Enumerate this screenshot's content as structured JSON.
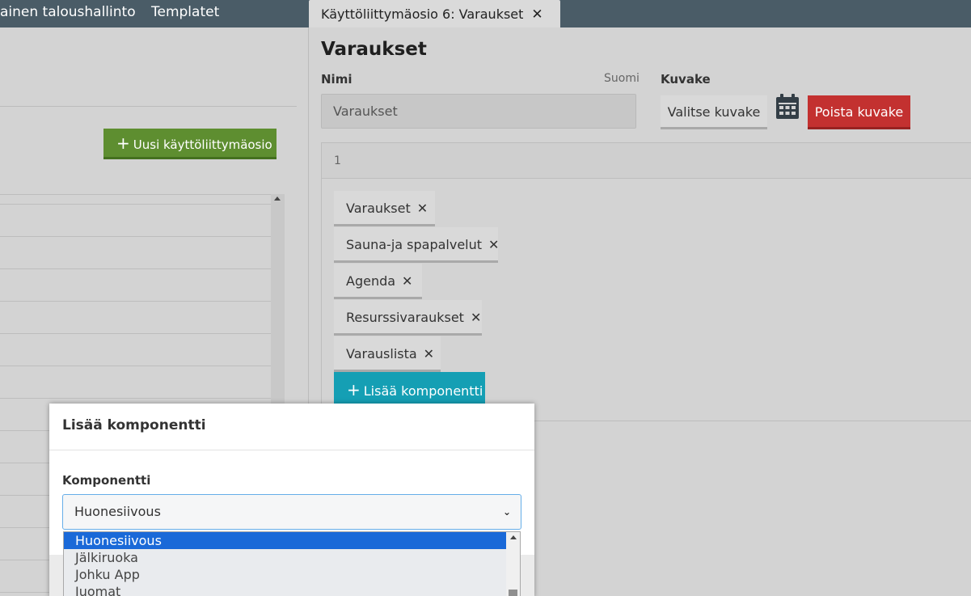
{
  "topbar": {
    "nav_items": [
      "ainen taloushallinto",
      "Templatet"
    ],
    "tab": {
      "label": "Käyttöliittymäosio 6: Varaukset",
      "close": "✕"
    }
  },
  "left": {
    "add_button": "Uusi käyttöliittymäosio",
    "add_icon": "plus-icon"
  },
  "form": {
    "title": "Varaukset",
    "name_label": "Nimi",
    "language": "Suomi",
    "name_value": "Varaukset",
    "icon_label": "Kuvake",
    "choose_icon_button": "Valitse kuvake",
    "icon": "calendar-icon",
    "remove_icon_button": "Poista kuvake"
  },
  "section": {
    "number": "1",
    "components": [
      {
        "label": "Varaukset",
        "close": "✕"
      },
      {
        "label": "Sauna-ja spapalvelut",
        "close": "✕"
      },
      {
        "label": "Agenda",
        "close": "✕"
      },
      {
        "label": "Resurssivaraukset",
        "close": "✕"
      },
      {
        "label": "Varauslista",
        "close": "✕"
      }
    ],
    "add_component_button": "Lisää komponentti"
  },
  "modal": {
    "title": "Lisää komponentti",
    "field_label": "Komponentti",
    "selected": "Huonesiivous",
    "options": [
      "Huonesiivous",
      "Jälkiruoka",
      "Johku App",
      "Juomat"
    ]
  },
  "colors": {
    "topbar": "#4a5c67",
    "green": "#5e8e30",
    "red": "#c33130",
    "teal": "#159fb4",
    "selection": "#1a69d8"
  }
}
